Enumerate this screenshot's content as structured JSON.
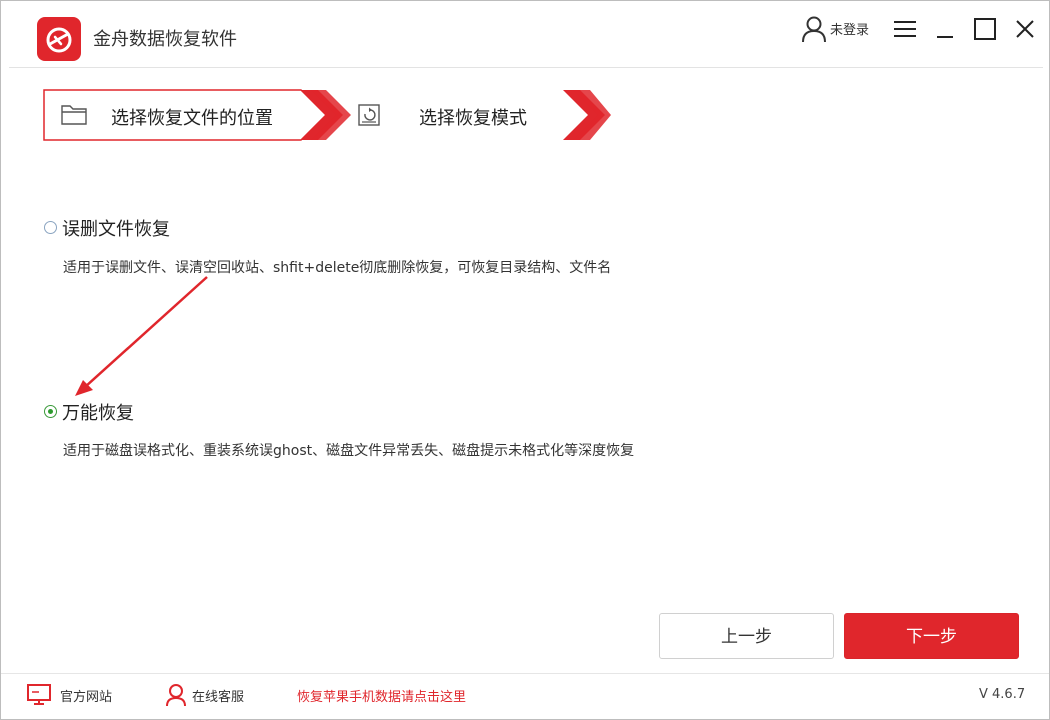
{
  "app": {
    "title": "金舟数据恢复软件",
    "login_label": "未登录",
    "version": "V 4.6.7"
  },
  "steps": [
    {
      "label": "选择恢复文件的位置",
      "icon": "folder-icon"
    },
    {
      "label": "选择恢复模式",
      "icon": "restore-disk-icon"
    }
  ],
  "options": [
    {
      "title": "误删文件恢复",
      "desc": "适用于误删文件、误清空回收站、shfit+delete彻底删除恢复，可恢复目录结构、文件名",
      "selected": false
    },
    {
      "title": "万能恢复",
      "desc": "适用于磁盘误格式化、重装系统误ghost、磁盘文件异常丢失、磁盘提示未格式化等深度恢复",
      "selected": true
    }
  ],
  "buttons": {
    "prev": "上一步",
    "next": "下一步"
  },
  "footer": {
    "website": "官方网站",
    "support": "在线客服",
    "apple_link": "恢复苹果手机数据请点击这里"
  },
  "colors": {
    "brand_red": "#e0262c",
    "radio_green": "#2d9a2d"
  },
  "icons": [
    "app-logo-icon",
    "user-icon",
    "menu-icon",
    "maximize-icon",
    "minimize-icon",
    "close-icon",
    "monitor-icon",
    "support-agent-icon"
  ]
}
